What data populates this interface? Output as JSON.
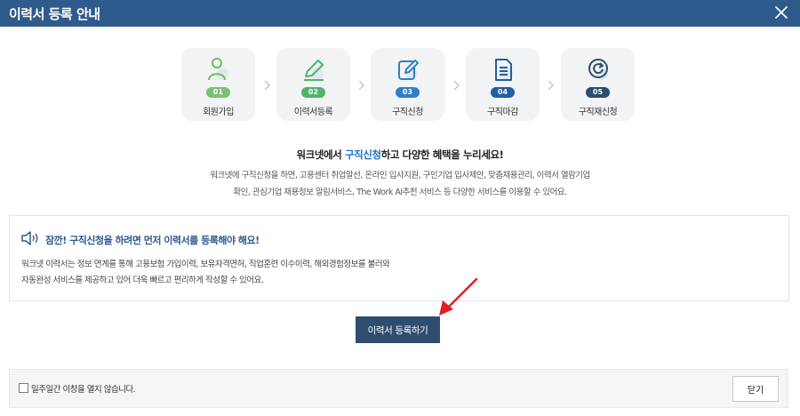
{
  "dialog": {
    "title": "이력서 등록 안내"
  },
  "steps": [
    {
      "num": "01",
      "label": "회원가입",
      "icon": "person-icon",
      "color": "#7cc070"
    },
    {
      "num": "02",
      "label": "이력서등록",
      "icon": "pencil-icon",
      "color": "#4fb36a"
    },
    {
      "num": "03",
      "label": "구직신청",
      "icon": "edit-document-icon",
      "color": "#2f7fc7"
    },
    {
      "num": "04",
      "label": "구직마감",
      "icon": "document-icon",
      "color": "#1e5fa8"
    },
    {
      "num": "05",
      "label": "구직재신청",
      "icon": "refresh-icon",
      "color": "#2c4c70"
    }
  ],
  "headline": {
    "before": "워크넷에서 ",
    "highlight": "구직신청",
    "after": "하고 다양한 혜택을 누리세요!"
  },
  "description": [
    "워크넷에 구직신청을 하면, 고용센터 취업알선, 온라인 입사지원, 구인기업 입사제안, 맞춤채용관리, 이력서 열람기업",
    "확인, 관심기업 채용정보 알림서비스, The Work AI추천 서비스 등 다양한 서비스를 이용할 수 있어요."
  ],
  "notice": {
    "title": "잠깐! 구직신청을 하려면 먼저 이력서를 등록해야 해요!",
    "lines": [
      "워크넷 이력서는 정보 연계를 통해 고용보험 가입이력, 보유자격면허, 직업훈련 이수이력, 해외경험정보를 불러와",
      "자동완성 서비스를 제공하고 있어 더욱 빠르고 편리하게 작성할 수 있어요."
    ]
  },
  "register_button": "이력서 등록하기",
  "footer": {
    "checkbox_label": "일주일간 이창을 열지 않습니다.",
    "close_button": "닫기"
  },
  "colors": {
    "titlebar": "#2f5b8c",
    "highlight": "#1a73c6",
    "primary_button": "#2f4d6f",
    "arrow": "#e02020"
  }
}
